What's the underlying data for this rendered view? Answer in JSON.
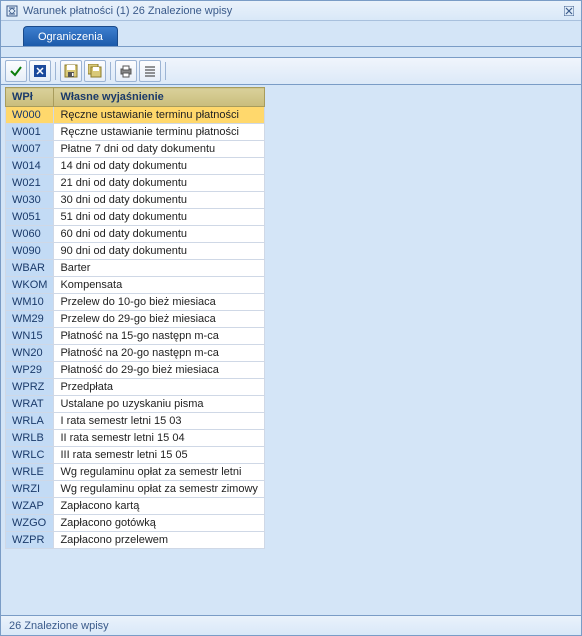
{
  "titlebar": {
    "title": "Warunek płatności (1)   26 Znalezione wpisy"
  },
  "tab": {
    "label": "Ograniczenia"
  },
  "toolbar": {
    "accept": "OK",
    "cancel": "Anuluj",
    "save1": "Zapisz",
    "save2": "Zapisz jako",
    "print": "Drukuj",
    "settings": "Ustawienia"
  },
  "table": {
    "headers": {
      "code": "WPł",
      "desc": "Własne wyjaśnienie"
    },
    "rows": [
      {
        "code": "W000",
        "desc": "Ręczne ustawianie terminu płatności",
        "selected": true
      },
      {
        "code": "W001",
        "desc": "Ręczne ustawianie terminu płatności"
      },
      {
        "code": "W007",
        "desc": "Płatne 7 dni od daty dokumentu"
      },
      {
        "code": "W014",
        "desc": "14 dni od daty dokumentu"
      },
      {
        "code": "W021",
        "desc": "21 dni od daty dokumentu"
      },
      {
        "code": "W030",
        "desc": "30 dni od daty  dokumentu"
      },
      {
        "code": "W051",
        "desc": "51 dni od daty  dokumentu"
      },
      {
        "code": "W060",
        "desc": "60 dni od daty  dokumentu"
      },
      {
        "code": "W090",
        "desc": "90 dni od daty  dokumentu"
      },
      {
        "code": "WBAR",
        "desc": "Barter"
      },
      {
        "code": "WKOM",
        "desc": "Kompensata"
      },
      {
        "code": "WM10",
        "desc": "Przelew do 10-go bież miesiaca"
      },
      {
        "code": "WM29",
        "desc": "Przelew do 29-go bież miesiaca"
      },
      {
        "code": "WN15",
        "desc": "Płatność na 15-go następn m-ca"
      },
      {
        "code": "WN20",
        "desc": "Płatność na 20-go następn m-ca"
      },
      {
        "code": "WP29",
        "desc": "Płatność do 29-go bież miesiaca"
      },
      {
        "code": "WPRZ",
        "desc": "Przedpłata"
      },
      {
        "code": "WRAT",
        "desc": "Ustalane po uzyskaniu pisma"
      },
      {
        "code": "WRLA",
        "desc": "I rata semestr letni 15 03"
      },
      {
        "code": "WRLB",
        "desc": "II rata semestr letni 15 04"
      },
      {
        "code": "WRLC",
        "desc": "III rata semestr letni 15 05"
      },
      {
        "code": "WRLE",
        "desc": "Wg regulaminu opłat za semestr letni"
      },
      {
        "code": "WRZI",
        "desc": "Wg regulaminu opłat za semestr zimowy"
      },
      {
        "code": "WZAP",
        "desc": "Zapłacono kartą"
      },
      {
        "code": "WZGO",
        "desc": "Zapłacono gotówką"
      },
      {
        "code": "WZPR",
        "desc": "Zapłacono przelewem"
      }
    ]
  },
  "statusbar": {
    "text": "26 Znalezione wpisy"
  }
}
